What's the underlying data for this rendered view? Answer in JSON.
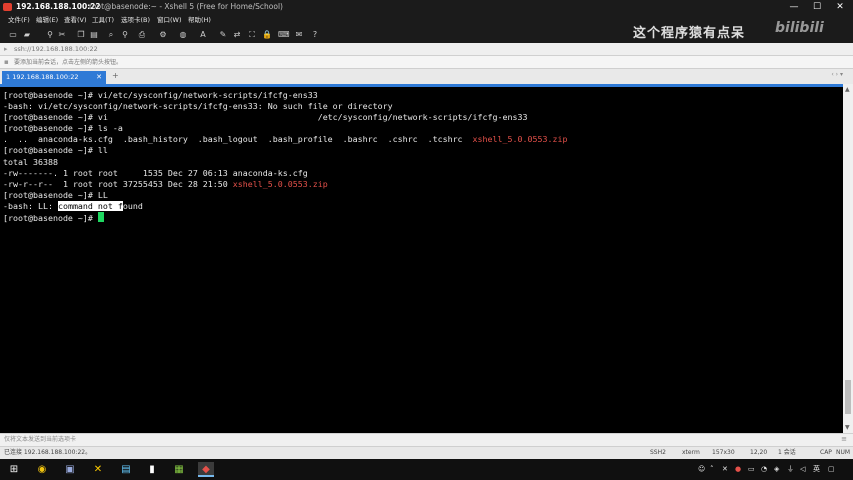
{
  "window": {
    "title_host": "192.168.188.100:22",
    "title_sub": "root@basenode:~ - Xshell 5 (Free for Home/School)",
    "minimize": "—",
    "maximize": "☐",
    "close": "✕"
  },
  "menu": [
    "文件(F)",
    "编辑(E)",
    "查看(V)",
    "工具(T)",
    "选项卡(B)",
    "窗口(W)",
    "帮助(H)"
  ],
  "address": {
    "value": "ssh://192.168.188.100:22"
  },
  "hint": {
    "text": "要添加当前会话，点击左侧的箭头按钮。"
  },
  "tabs": [
    {
      "label": "1 192.168.188.100:22",
      "active": true
    }
  ],
  "tab_nav": "‹ ›  ▾",
  "terminal": {
    "l1": "[root@basenode ~]# vi/etc/sysconfig/network-scripts/ifcfg-ens33",
    "l2": "-bash: vi/etc/sysconfig/network-scripts/ifcfg-ens33: No such file or directory",
    "l3": "[root@basenode ~]# vi                                          /etc/sysconfig/network-scripts/ifcfg-ens33",
    "l4": "[root@basenode ~]# ls -a",
    "l5": ".  ..  anaconda-ks.cfg  .bash_history  .bash_logout  .bash_profile  .bashrc  .cshrc  .tcshrc  ",
    "l5_red": "xshell_5.0.0553.zip",
    "l6": "[root@basenode ~]# ll",
    "l7": "total 36388",
    "l8": "-rw-------. 1 root root     1535 Dec 27 06:13 anaconda-ks.cfg",
    "l9": "-rw-r--r--  1 root root 37255453 Dec 28 21:50 ",
    "l9_red": "xshell_5.0.0553.zip",
    "l10": "[root@basenode ~]# LL",
    "l11a": "-bash: LL: ",
    "l11_sel": "command not f",
    "l11b": "ound",
    "l12": "[root@basenode ~]# "
  },
  "compose": {
    "placeholder": "仅将文本发送到当前选项卡"
  },
  "status": {
    "connected": "已连接 192.168.188.100:22。",
    "protocol": "SSH2",
    "term": "xterm",
    "size": "157x30",
    "pos": "12,20",
    "sessions": "1 会话",
    "caps": "CAP",
    "num": "NUM"
  },
  "taskbar": {
    "ime": "英"
  },
  "watermark": {
    "text": "这个程序猿有点呆",
    "logo": "bilibili"
  }
}
